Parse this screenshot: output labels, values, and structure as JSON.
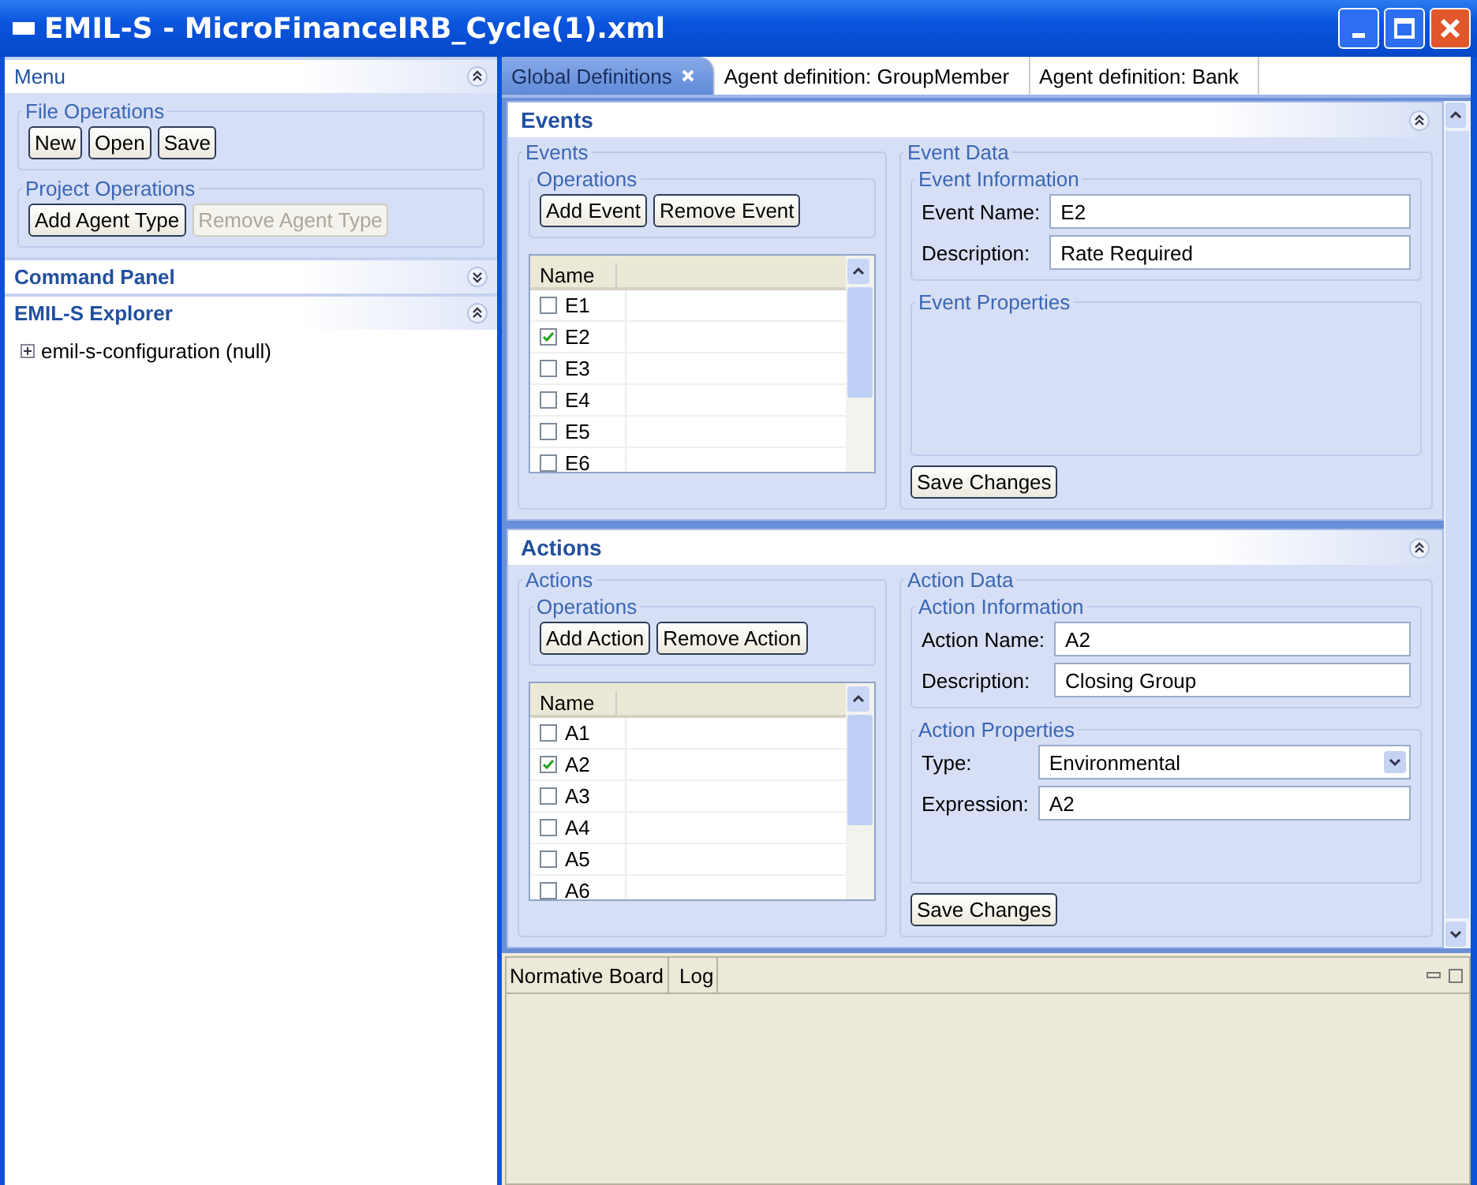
{
  "window": {
    "title": "EMIL-S - MicroFinanceIRB_Cycle(1).xml"
  },
  "menu": {
    "title": "Menu",
    "expanded": true,
    "groups": [
      {
        "title": "File Operations",
        "buttons": [
          {
            "label": "New",
            "disabled": false
          },
          {
            "label": "Open",
            "disabled": false
          },
          {
            "label": "Save",
            "disabled": false
          }
        ]
      },
      {
        "title": "Project Operations",
        "buttons": [
          {
            "label": "Add Agent Type",
            "disabled": false
          },
          {
            "label": "Remove Agent Type",
            "disabled": true
          }
        ]
      }
    ]
  },
  "command_panel": {
    "title": "Command Panel",
    "expanded": false
  },
  "explorer": {
    "title": "EMIL-S Explorer",
    "expanded": true,
    "tree": [
      {
        "label": "emil-s-configuration (null)",
        "expanded": false
      }
    ]
  },
  "editor_tabs": [
    {
      "label": "Global Definitions",
      "selected": true,
      "closable": true
    },
    {
      "label": "Agent definition: GroupMember",
      "selected": false,
      "closable": false
    },
    {
      "label": "Agent definition: Bank",
      "selected": false,
      "closable": false
    }
  ],
  "sections": [
    {
      "title": "Events",
      "expanded": true,
      "list_title": "Events",
      "operations_title": "Operations",
      "buttons": [
        "Add Event",
        "Remove Event"
      ],
      "list_header": "Name",
      "items": [
        {
          "label": "E1",
          "checked": false
        },
        {
          "label": "E2",
          "checked": true
        },
        {
          "label": "E3",
          "checked": false
        },
        {
          "label": "E4",
          "checked": false
        },
        {
          "label": "E5",
          "checked": false
        },
        {
          "label": "E6",
          "checked": false
        }
      ],
      "data_title": "Event Data",
      "info_title": "Event Information",
      "info_fields": [
        {
          "kind": "text",
          "label": "Event Name:",
          "value": "E2"
        },
        {
          "kind": "text",
          "label": "Description:",
          "value": "Rate Required"
        }
      ],
      "properties_title": "Event Properties",
      "save": "Save Changes"
    },
    {
      "title": "Actions",
      "expanded": true,
      "list_title": "Actions",
      "operations_title": "Operations",
      "buttons": [
        "Add Action",
        "Remove Action"
      ],
      "list_header": "Name",
      "items": [
        {
          "label": "A1",
          "checked": false
        },
        {
          "label": "A2",
          "checked": true
        },
        {
          "label": "A3",
          "checked": false
        },
        {
          "label": "A4",
          "checked": false
        },
        {
          "label": "A5",
          "checked": false
        },
        {
          "label": "A6",
          "checked": false
        }
      ],
      "data_title": "Action Data",
      "info_title": "Action Information",
      "info_fields": [
        {
          "kind": "text",
          "label": "Action Name:",
          "value": "A2"
        },
        {
          "kind": "text",
          "label": "Description:",
          "value": "Closing Group"
        }
      ],
      "properties_title": "Action Properties",
      "properties_fields": [
        {
          "kind": "select",
          "label": "Type:",
          "value": "Environmental"
        },
        {
          "kind": "text",
          "label": "Expression:",
          "value": "A2"
        }
      ],
      "save": "Save Changes"
    }
  ],
  "bottom_view": {
    "tabs": [
      {
        "label": "Normative Board"
      },
      {
        "label": "Log"
      }
    ]
  }
}
